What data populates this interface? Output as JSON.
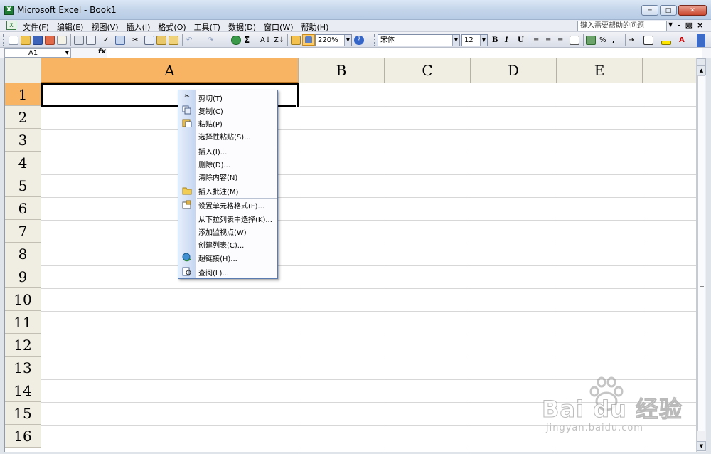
{
  "window": {
    "title": "Microsoft Excel - Book1",
    "app_icon": "excel-icon"
  },
  "menubar": {
    "items": [
      "文件(F)",
      "编辑(E)",
      "视图(V)",
      "插入(I)",
      "格式(O)",
      "工具(T)",
      "数据(D)",
      "窗口(W)",
      "帮助(H)"
    ],
    "help_placeholder": "键入需要帮助的问题"
  },
  "toolbar": {
    "zoom": "220%",
    "font": "宋体",
    "font_size": "12",
    "bold": "B",
    "italic": "I",
    "underline": "U",
    "percent": "%",
    "comma": ","
  },
  "formulabar": {
    "name_box": "A1",
    "fx": "fx",
    "content": ""
  },
  "sheet": {
    "columns": [
      "A",
      "B",
      "C",
      "D",
      "E"
    ],
    "rows": [
      "1",
      "2",
      "3",
      "4",
      "5",
      "6",
      "7",
      "8",
      "9",
      "10",
      "11",
      "12",
      "13",
      "14",
      "15",
      "16"
    ],
    "selected_cell": "A1",
    "accent_color": "#f8b462"
  },
  "context_menu": {
    "items": [
      {
        "label": "剪切(T)",
        "icon": "cut-icon"
      },
      {
        "label": "复制(C)",
        "icon": "copy-icon"
      },
      {
        "label": "粘贴(P)",
        "icon": "paste-icon"
      },
      {
        "label": "选择性粘贴(S)...",
        "icon": ""
      },
      {
        "label": "插入(I)...",
        "icon": ""
      },
      {
        "label": "删除(D)...",
        "icon": ""
      },
      {
        "label": "清除内容(N)",
        "icon": ""
      },
      {
        "label": "插入批注(M)",
        "icon": "comment-icon"
      },
      {
        "label": "设置单元格格式(F)...",
        "icon": "format-cells-icon"
      },
      {
        "label": "从下拉列表中选择(K)...",
        "icon": ""
      },
      {
        "label": "添加监视点(W)",
        "icon": ""
      },
      {
        "label": "创建列表(C)...",
        "icon": ""
      },
      {
        "label": "超链接(H)...",
        "icon": "hyperlink-icon"
      },
      {
        "label": "查阅(L)...",
        "icon": "research-icon"
      }
    ]
  },
  "watermark": {
    "brand": "Bai du 经验",
    "url": "jingyan.baidu.com"
  }
}
